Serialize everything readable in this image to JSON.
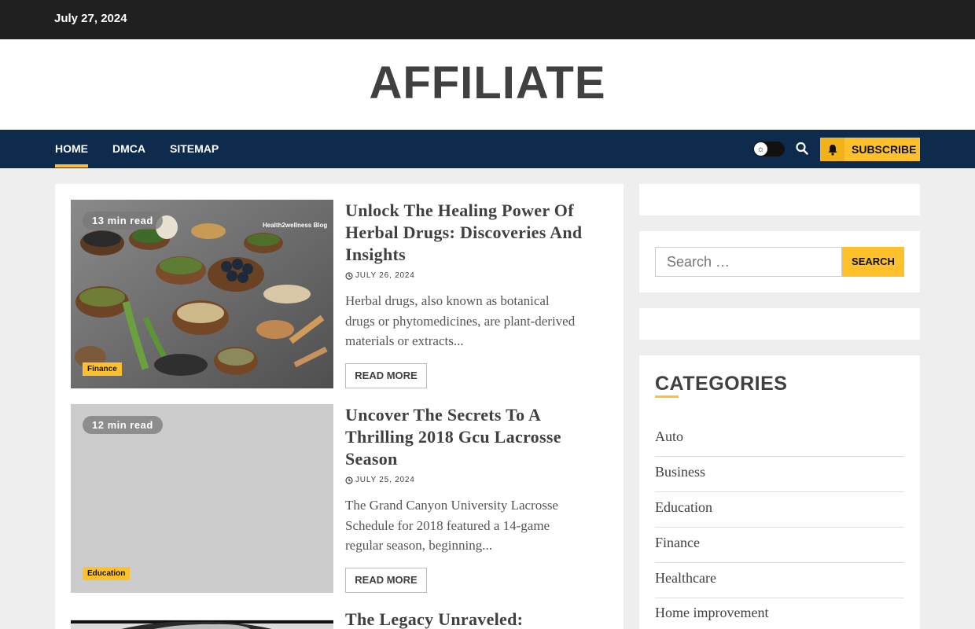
{
  "topbar": {
    "date": "July 27, 2024"
  },
  "site": {
    "title": "AFFILIATE"
  },
  "nav": {
    "items": [
      {
        "label": "HOME",
        "active": true
      },
      {
        "label": "DMCA",
        "active": false
      },
      {
        "label": "SITEMAP",
        "active": false
      }
    ],
    "subscribe_label": "SUBSCRIBE",
    "icons": [
      "sun-icon",
      "search-icon",
      "bell-icon"
    ]
  },
  "posts": [
    {
      "read_time": "13 min read",
      "image_watermark": "Health2wellness Blog",
      "category": "Finance",
      "title": "Unlock The Healing Power Of Herbal Drugs: Discoveries And Insights",
      "date": "JULY 26, 2024",
      "excerpt": "Herbal drugs, also known as botanical drugs or phytomedicines, are plant-derived materials or extracts...",
      "read_more": "READ MORE"
    },
    {
      "read_time": "12 min read",
      "category": "Education",
      "title": "Uncover The Secrets To A Thrilling 2018 Gcu Lacrosse Season",
      "date": "JULY 25, 2024",
      "excerpt": "The Grand Canyon University Lacrosse Schedule for 2018 featured a 14-game regular season, beginning...",
      "read_more": "READ MORE"
    },
    {
      "title": "The Legacy Unraveled:"
    }
  ],
  "sidebar": {
    "search": {
      "placeholder": "Search …",
      "button": "SEARCH"
    },
    "categories": {
      "heading": "CATEGORIES",
      "items": [
        "Auto",
        "Business",
        "Education",
        "Finance",
        "Healthcare",
        "Home improvement"
      ]
    }
  },
  "colors": {
    "accent": "#ffc12b",
    "nav_bg": "#0e2a4d",
    "topbar_bg": "#202020"
  }
}
